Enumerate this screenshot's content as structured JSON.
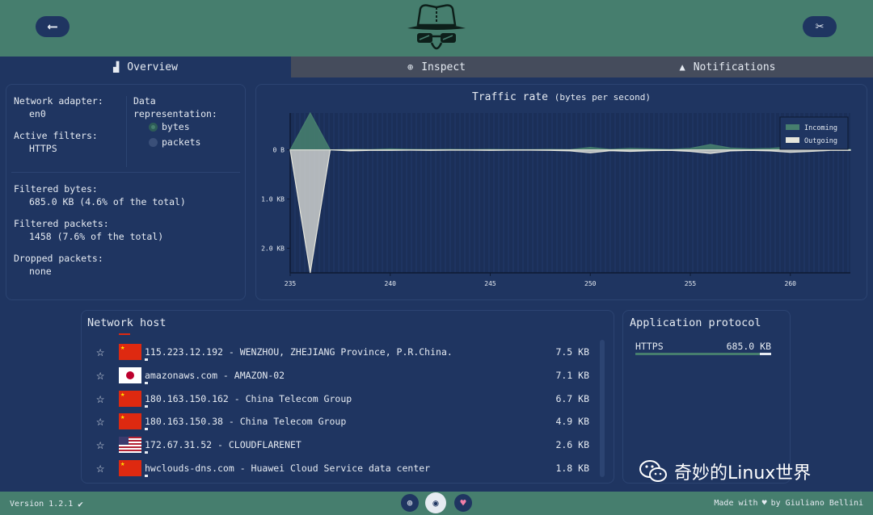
{
  "header": {
    "back_icon": "back-arrow-icon",
    "settings_icon": "settings-tools-icon",
    "logo_icon": "sniffer-hat-logo"
  },
  "tabs": [
    {
      "label": "Overview",
      "icon": "chart-icon",
      "active": true
    },
    {
      "label": "Inspect",
      "icon": "magnifier-icon",
      "active": false
    },
    {
      "label": "Notifications",
      "icon": "bell-icon",
      "active": false
    }
  ],
  "info": {
    "adapter_label": "Network adapter:",
    "adapter_value": "en0",
    "filters_label": "Active filters:",
    "filters_value": "HTTPS",
    "representation_label": "Data representation:",
    "option_bytes": "bytes",
    "option_packets": "packets",
    "selected": "bytes",
    "filtered_bytes_label": "Filtered bytes:",
    "filtered_bytes_value": "685.0 KB (4.6% of the total)",
    "filtered_packets_label": "Filtered packets:",
    "filtered_packets_value": "1458 (7.6% of the total)",
    "dropped_label": "Dropped packets:",
    "dropped_value": "none"
  },
  "traffic_chart": {
    "title": "Traffic rate",
    "subtitle": "(bytes per second)"
  },
  "chart_data": {
    "type": "area",
    "title": "Traffic rate (bytes per second)",
    "xlabel": "",
    "ylabel": "",
    "x_ticks": [
      "235",
      "240",
      "245",
      "250",
      "255",
      "260"
    ],
    "y_ticks": [
      "0 B",
      "1.0 KB",
      "2.0 KB"
    ],
    "xlim": [
      235,
      263
    ],
    "ylim": [
      -2500,
      750
    ],
    "legend_position": "top-right",
    "x": [
      235,
      236,
      237,
      238,
      239,
      240,
      241,
      242,
      243,
      244,
      245,
      246,
      247,
      248,
      249,
      250,
      251,
      252,
      253,
      254,
      255,
      256,
      257,
      258,
      259,
      260,
      261,
      262,
      263
    ],
    "series": [
      {
        "name": "Incoming",
        "color": "#467e6e",
        "values": [
          0,
          750,
          0,
          10,
          5,
          20,
          10,
          5,
          10,
          5,
          10,
          5,
          5,
          10,
          5,
          50,
          10,
          30,
          20,
          10,
          30,
          110,
          40,
          20,
          30,
          60,
          20,
          10,
          10
        ]
      },
      {
        "name": "Outgoing",
        "color": "#e6e6dc",
        "values": [
          0,
          -2500,
          0,
          -20,
          -10,
          -10,
          -5,
          -10,
          -5,
          -5,
          -10,
          -5,
          -5,
          -10,
          -20,
          -60,
          -15,
          -30,
          -15,
          -10,
          -30,
          -70,
          -20,
          -10,
          -20,
          -50,
          -30,
          -10,
          -10
        ]
      }
    ]
  },
  "hosts": {
    "title": "Network host",
    "rows": [
      {
        "flag": "cn",
        "name": "115.223.12.192 - WENZHOU, ZHEJIANG Province, P.R.China.",
        "size": "7.5 KB"
      },
      {
        "flag": "jp",
        "name": "amazonaws.com - AMAZON-02",
        "size": "7.1 KB"
      },
      {
        "flag": "cn",
        "name": "180.163.150.162 - China Telecom Group",
        "size": "6.7 KB"
      },
      {
        "flag": "cn",
        "name": "180.163.150.38 - China Telecom Group",
        "size": "4.9 KB"
      },
      {
        "flag": "us",
        "name": "172.67.31.52 - CLOUDFLARENET",
        "size": "2.6 KB"
      },
      {
        "flag": "cn",
        "name": "hwclouds-dns.com - Huawei Cloud Service data center",
        "size": "1.8 KB"
      }
    ]
  },
  "protocols": {
    "title": "Application protocol",
    "rows": [
      {
        "name": "HTTPS",
        "size": "685.0 KB"
      }
    ]
  },
  "footer": {
    "version": "Version 1.2.1",
    "made_with": "Made with",
    "by": "by Giuliano Bellini"
  },
  "watermark": {
    "text": "奇妙的Linux世界",
    "icon": "wechat-icon"
  }
}
